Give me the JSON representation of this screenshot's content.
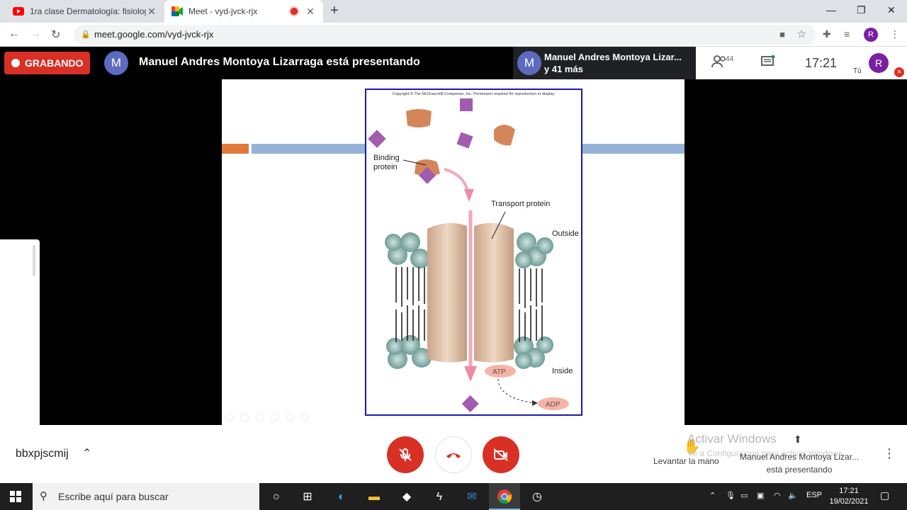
{
  "browser": {
    "tabs": [
      {
        "title": "1ra clase Dermatología: fisiologí",
        "icon": "youtube-icon"
      },
      {
        "title": "Meet - vyd-jvck-rjx",
        "icon": "meet-icon"
      }
    ],
    "url": "meet.google.com/vyd-jvck-rjx",
    "profile_initial": "R"
  },
  "meet": {
    "recording_label": "GRABANDO",
    "presenter_initial": "M",
    "presenting_text": "Manuel Andres Montoya Lizarraga está presentando",
    "speaker_name": "Manuel Andres Montoya Lizar...",
    "speaker_more": "y 41 más",
    "participants_count": "44",
    "clock": "17:21",
    "self_label": "Tú",
    "self_initial": "R",
    "meeting_code": "bbxpjscmij",
    "raise_hand_label": "Levantar la mano",
    "presenting_footer_name": "Manuel Andres Montoya Lizar...",
    "presenting_footer_text": "está presentando",
    "accent": "#d93025"
  },
  "slide": {
    "copyright": "Copyright © The McGraw-Hill Companies, Inc. Permission required for reproduction or display.",
    "labels": {
      "binding": "Binding",
      "protein": "protein",
      "transport": "Transport protein",
      "outside": "Outside",
      "inside": "Inside",
      "atp": "ATP",
      "adp": "ADP"
    }
  },
  "watermark": {
    "line1": "Activar Windows",
    "line2": "Ve a Configuración para activar Windows."
  },
  "taskbar": {
    "search_placeholder": "Escribe aquí para buscar",
    "lang": "ESP",
    "time": "17:21",
    "date": "19/02/2021"
  }
}
